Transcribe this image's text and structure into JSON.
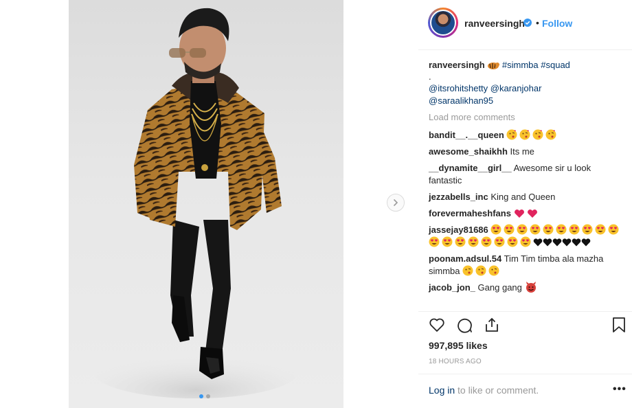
{
  "post": {
    "username": "ranveersingh",
    "follow_label": "Follow",
    "separator": "•",
    "caption": {
      "username": "ranveersingh",
      "tags": "#simmba #squad",
      "line2": ".",
      "mentions_line1": "@itsrohitshetty @karanjohar",
      "mentions_line2": "@saraalikhan95"
    },
    "load_more": "Load more comments",
    "comments": [
      {
        "user": "bandit__.__queen",
        "text": ""
      },
      {
        "user": "awesome_shaikhh",
        "text": "Its me"
      },
      {
        "user": "__dynamite__girl__",
        "text": "Awesome sir u look fantastic"
      },
      {
        "user": "jezzabells_inc",
        "text": "King and Queen"
      },
      {
        "user": "forevermaheshfans",
        "text": ""
      },
      {
        "user": "jassejay81686",
        "text": ""
      },
      {
        "user": "poonam.adsul.54",
        "text": "Tim Tim timba ala mazha simmba"
      },
      {
        "user": "jacob_jon_",
        "text": "Gang gang"
      }
    ],
    "likes": "997,895 likes",
    "time": "18 HOURS AGO",
    "login_link": "Log in",
    "login_rest": " to like or comment.",
    "more": "•••"
  },
  "icons": [
    "verified-badge-icon",
    "heart-icon",
    "comment-icon",
    "share-icon",
    "bookmark-icon",
    "chevron-right-icon",
    "tiger-emoji",
    "kiss-emoji",
    "heart-eyes-emoji",
    "red-heart-emoji",
    "black-heart-emoji",
    "devil-emoji"
  ],
  "colors": {
    "link": "#3897f0",
    "mention": "#003569",
    "muted": "#999999",
    "emoji_yellow": "#f9c22b",
    "heart_red": "#e0245e"
  }
}
